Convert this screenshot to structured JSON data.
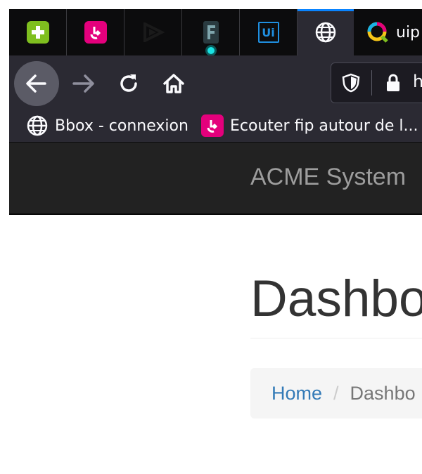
{
  "tabs": [
    {
      "name": "tab-add-extension",
      "icon": "green-plus-icon"
    },
    {
      "name": "tab-fip-radio",
      "icon": "fip-radio-icon"
    },
    {
      "name": "tab-media-player",
      "icon": "play-triangle-icon"
    },
    {
      "name": "tab-f-app",
      "icon": "f-app-icon",
      "playing_audio": true
    },
    {
      "name": "tab-uipath",
      "icon": "uipath-ui-icon",
      "icon_text": "Ui"
    },
    {
      "name": "tab-current-page",
      "icon": "globe-icon",
      "active": true
    },
    {
      "name": "tab-uipath-qlik",
      "icon": "q-logo-icon",
      "label": "uip"
    }
  ],
  "navbar": {
    "back_icon": "arrow-left-icon",
    "forward_icon": "arrow-right-icon",
    "reload_icon": "reload-icon",
    "home_icon": "home-icon",
    "url_text": "h"
  },
  "bookmarks": [
    {
      "label": "Bbox - connexion",
      "icon": "globe-icon"
    },
    {
      "label": "Ecouter fip autour de l...",
      "icon": "fip-radio-icon"
    }
  ],
  "site": {
    "brand": "ACME System"
  },
  "page": {
    "title": "Dashbo",
    "breadcrumb": {
      "home": "Home",
      "separator": "/",
      "current": "Dashbo"
    }
  },
  "colors": {
    "tab_active_indicator": "#0a84ff",
    "fip_pink": "#e4007c",
    "plus_green": "#7fbf1f",
    "uipath_blue": "#1f8fe0",
    "link_blue": "#337ab7"
  }
}
